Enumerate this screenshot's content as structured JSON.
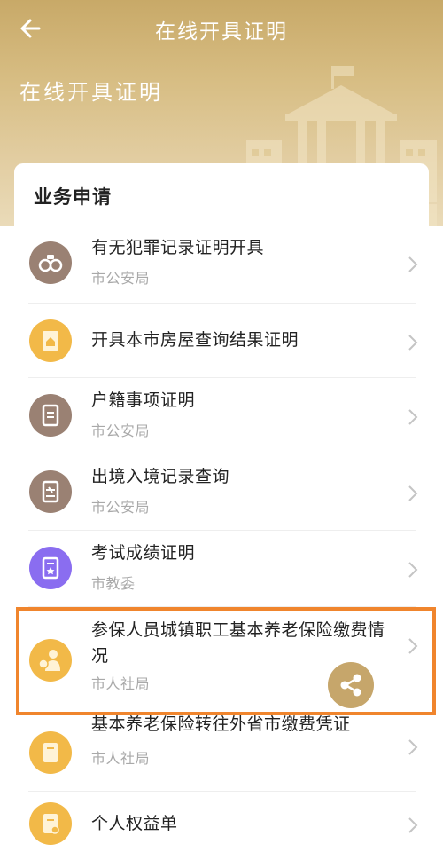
{
  "header": {
    "nav_title": "在线开具证明",
    "hero_title": "在线开具证明"
  },
  "card": {
    "title": "业务申请"
  },
  "items": [
    {
      "name": "有无犯罪记录证明开具",
      "dept": "市公安局",
      "icon": "handcuffs-icon"
    },
    {
      "name": "开具本市房屋查询结果证明",
      "dept": "",
      "icon": "house-document-icon"
    },
    {
      "name": "户籍事项证明",
      "dept": "市公安局",
      "icon": "document-icon"
    },
    {
      "name": "出境入境记录查询",
      "dept": "市公安局",
      "icon": "airplane-document-icon"
    },
    {
      "name": "考试成绩证明",
      "dept": "市教委",
      "icon": "certificate-icon"
    },
    {
      "name": "参保人员城镇职工基本养老保险缴费情况",
      "dept": "市人社局",
      "icon": "insurance-person-icon"
    },
    {
      "name": "基本养老保险转往外省市缴费凭证",
      "dept": "市人社局",
      "icon": "document-icon"
    },
    {
      "name": "个人权益单",
      "dept": "",
      "icon": "rights-document-icon"
    }
  ],
  "colors": {
    "header_gold": "#c8a968",
    "highlight_orange": "#f0852d",
    "share_gold": "#c6a66b"
  }
}
